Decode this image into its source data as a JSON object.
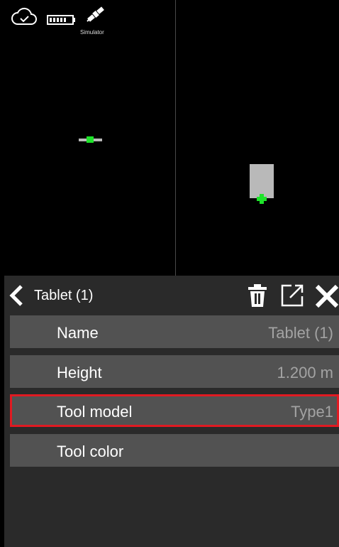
{
  "status": {
    "simulator_label": "Simulator"
  },
  "icons": {
    "cloud": "cloud-check-icon",
    "battery": "battery-icon",
    "satellite": "satellite-icon",
    "back": "chevron-left-icon",
    "trash": "trash-icon",
    "open": "open-external-icon",
    "close": "close-icon"
  },
  "panel": {
    "title": "Tablet (1)",
    "rows": [
      {
        "label": "Name",
        "value": "Tablet (1)"
      },
      {
        "label": "Height",
        "value": "1.200 m"
      },
      {
        "label": "Tool model",
        "value": "Type1"
      },
      {
        "label": "Tool color",
        "value": ""
      }
    ]
  },
  "colors": {
    "background": "#000000",
    "panel": "#2a2a2a",
    "row": "#525252",
    "value_text": "#a3a3a3",
    "selection": "#e01a22",
    "marker_green": "#1ee32a",
    "object_gray": "#b9b9b9"
  }
}
